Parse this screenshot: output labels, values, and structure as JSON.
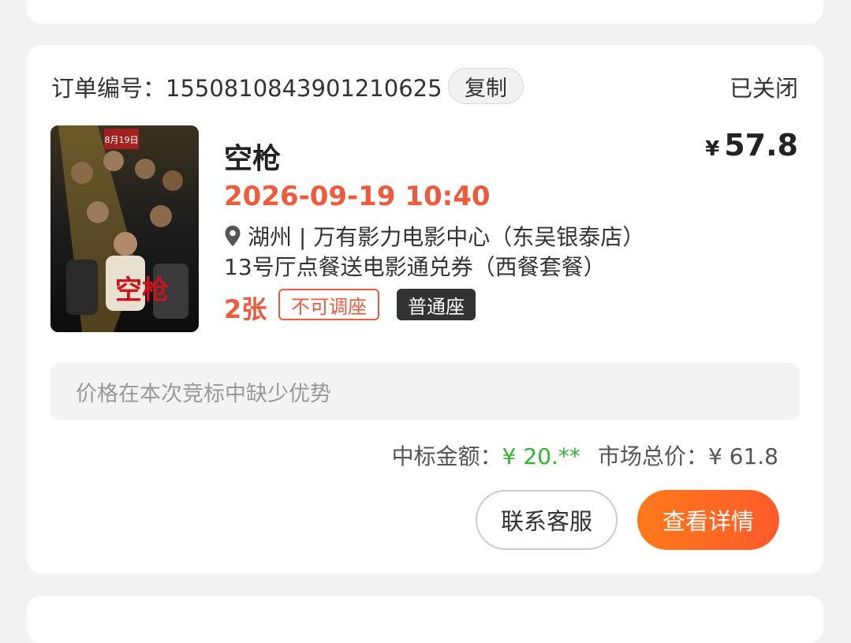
{
  "order": {
    "label": "订单编号：1550810843901210625",
    "copy_label": "复制",
    "status": "已关闭"
  },
  "movie": {
    "title": "空枪",
    "currency": "¥",
    "price": "57.8",
    "showtime": "2026-09-19 10:40",
    "cinema": "湖州 | 万有影力电影中心（东吴银泰店）",
    "hall": "13号厅点餐送电影通兑券（西餐套餐）",
    "ticket_count": "2张",
    "seat_tag": "不可调座",
    "seat_type": "普通座",
    "poster_title": "空枪",
    "poster_date": "8月19日"
  },
  "notice": "价格在本次竞标中缺少优势",
  "bid": {
    "winning_label": "中标金额：",
    "winning_value": "¥ 20.**",
    "market_label": "市场总价：",
    "market_value": "¥ 61.8"
  },
  "actions": {
    "service": "联系客服",
    "detail": "查看详情"
  },
  "colors": {
    "accent": "#ef5a3c",
    "green": "#2fb52f",
    "button_gradient_start": "#ff7a1a",
    "button_gradient_end": "#ff5a2a"
  },
  "icons": {
    "location": "location-pin-icon"
  }
}
